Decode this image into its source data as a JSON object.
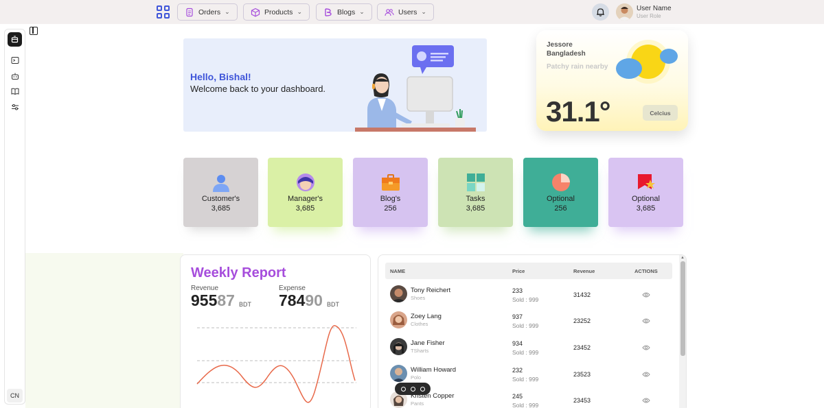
{
  "nav": {
    "items": [
      {
        "label": "Orders",
        "icon": "orders-icon"
      },
      {
        "label": "Products",
        "icon": "box-icon"
      },
      {
        "label": "Blogs",
        "icon": "blog-icon"
      },
      {
        "label": "Users",
        "icon": "users-icon"
      }
    ],
    "user_name": "User Name",
    "user_role": "User Role"
  },
  "sidebar": {
    "language": "CN"
  },
  "welcome": {
    "greeting": "Hello, Bishal!",
    "message": "Welcome back to your dashboard."
  },
  "weather": {
    "city": "Jessore",
    "country": "Bangladesh",
    "description": "Patchy rain nearby",
    "temperature": "31.1°",
    "unit": "Celcius"
  },
  "stats": [
    {
      "label": "Customer's",
      "value": "3,685",
      "color": "#d6d2d3"
    },
    {
      "label": "Manager's",
      "value": "3,685",
      "color": "#daf0a6"
    },
    {
      "label": "Blog's",
      "value": "256",
      "color": "#d6c3f0"
    },
    {
      "label": "Tasks",
      "value": "3,685",
      "color": "#cde3b4"
    },
    {
      "label": "Optional",
      "value": "256",
      "color": "#3fae97"
    },
    {
      "label": "Optional",
      "value": "3,685",
      "color": "#d9c4f2"
    }
  ],
  "report": {
    "title": "Weekly Report",
    "revenue_label": "Revenue",
    "revenue_main": "955",
    "revenue_light": "87",
    "expense_label": "Expense",
    "expense_main": "784",
    "expense_light": "90",
    "currency": "BDT"
  },
  "table": {
    "headers": {
      "name": "NAME",
      "price": "Price",
      "revenue": "Revenue",
      "actions": "ACTIONS"
    },
    "rows": [
      {
        "name": "Tony Reichert",
        "category": "Shoes",
        "price": "233",
        "sold": "Sold : 999",
        "revenue": "31432"
      },
      {
        "name": "Zoey Lang",
        "category": "Clothes",
        "price": "937",
        "sold": "Sold : 999",
        "revenue": "23252"
      },
      {
        "name": "Jane Fisher",
        "category": "TSharts",
        "price": "934",
        "sold": "Sold : 999",
        "revenue": "23452"
      },
      {
        "name": "William Howard",
        "category": "Polo",
        "price": "232",
        "sold": "Sold : 999",
        "revenue": "23523"
      },
      {
        "name": "Kristen Copper",
        "category": "Pants",
        "price": "245",
        "sold": "Sold : 999",
        "revenue": "23453"
      }
    ]
  },
  "colors": {
    "accent": "#3f55d9",
    "report_title": "#a64ddc",
    "line": "#e8694a"
  }
}
